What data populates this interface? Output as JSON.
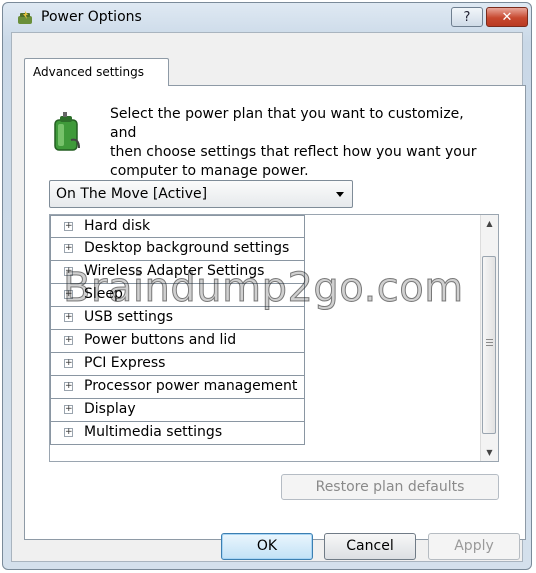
{
  "window": {
    "title": "Power Options",
    "help_label": "?",
    "close_label": "✕",
    "icon": "power-options-icon"
  },
  "tab": {
    "label": "Advanced settings"
  },
  "intro": {
    "icon": "battery-plug-icon",
    "line1": "Select the power plan that you want to customize, and",
    "line2": "then choose settings that reflect how you want your",
    "line3": "computer to manage power."
  },
  "plan": {
    "selected": "On The Move [Active]"
  },
  "settings": {
    "items": [
      {
        "label": "Hard disk"
      },
      {
        "label": "Desktop background settings"
      },
      {
        "label": "Wireless Adapter Settings"
      },
      {
        "label": "Sleep"
      },
      {
        "label": "USB settings"
      },
      {
        "label": "Power buttons and lid"
      },
      {
        "label": "PCI Express"
      },
      {
        "label": "Processor power management"
      },
      {
        "label": "Display"
      },
      {
        "label": "Multimedia settings"
      }
    ],
    "expander_glyph": "+"
  },
  "buttons": {
    "restore": "Restore plan defaults",
    "ok": "OK",
    "cancel": "Cancel",
    "apply": "Apply"
  },
  "watermark": "Braindump2go.com",
  "colors": {
    "close_button": "#c7482f",
    "title_gradient_top": "#dfe9f3",
    "ok_focus": "#3c7fb1"
  }
}
